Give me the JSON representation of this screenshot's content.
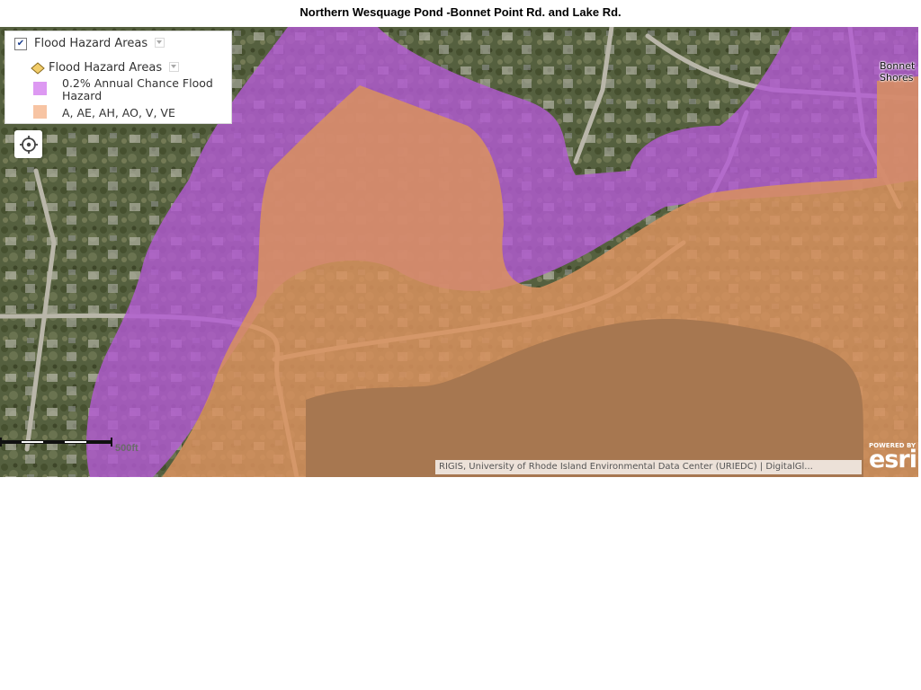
{
  "title": "Northern Wesquage Pond -Bonnet Point Rd. and  Lake Rd.",
  "legend": {
    "layer_checked": true,
    "layer_title": "Flood Hazard Areas",
    "sublayer_title": "Flood Hazard Areas",
    "items": [
      {
        "label_line1": "0.2% Annual Chance Flood",
        "label_line2": "Hazard",
        "color": "#dd99f2"
      },
      {
        "label": "A, AE, AH, AO, V, VE",
        "color": "#f7c4a3"
      }
    ]
  },
  "map": {
    "place_label_line1": "Bonnet",
    "place_label_line2": "Shores",
    "scale_label": "500ft",
    "attribution": "RIGIS, University of Rhode Island Environmental Data Center (URIEDC) | DigitalGl...",
    "esri_powered": "POWERED BY",
    "esri_logo": "esri",
    "colors": {
      "zone_02pct": "#b25ad2",
      "zone_a_ae": "#d9925e",
      "pond": "#8a6848",
      "imagery": "#5c6648"
    },
    "icons": [
      "locate-icon",
      "layer-checkbox-icon",
      "layer-caret-icon",
      "sublayer-symbol-icon"
    ]
  }
}
